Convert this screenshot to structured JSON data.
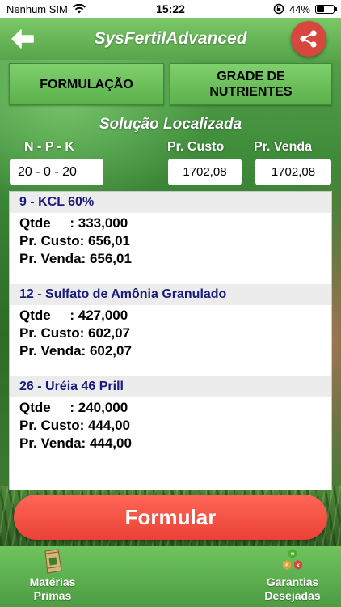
{
  "status_bar": {
    "carrier": "Nenhum SIM",
    "time": "15:22",
    "battery": "44%",
    "battery_level": 0.44
  },
  "header": {
    "title": "SysFertilAdvanced"
  },
  "tabs": [
    {
      "label": "FORMULAÇÃO"
    },
    {
      "label": "GRADE DE NUTRIENTES"
    }
  ],
  "solution": {
    "title": "Solução Localizada",
    "npk_label": "N - P - K",
    "npk_value": "20 - 0 - 20",
    "custo_label": "Pr. Custo",
    "custo_value": "1702,08",
    "venda_label": "Pr. Venda",
    "venda_value": "1702,08"
  },
  "items": [
    {
      "title": "9 - KCL 60%",
      "qtde_label": "Qtde     : ",
      "qtde": "333,000",
      "custo_label": "Pr. Custo: ",
      "custo": "656,01",
      "venda_label": "Pr. Venda: ",
      "venda": "656,01"
    },
    {
      "title": "12 - Sulfato de Amônia Granulado",
      "qtde_label": "Qtde     : ",
      "qtde": "427,000",
      "custo_label": "Pr. Custo: ",
      "custo": "602,07",
      "venda_label": "Pr. Venda: ",
      "venda": "602,07"
    },
    {
      "title": "26 - Uréia 46 Prill",
      "qtde_label": "Qtde     : ",
      "qtde": "240,000",
      "custo_label": "Pr. Custo: ",
      "custo": "444,00",
      "venda_label": "Pr. Venda: ",
      "venda": "444,00"
    }
  ],
  "formular_button": "Formular",
  "bottom_nav": {
    "left_line1": "Matérias",
    "left_line2": "Primas",
    "right_line1": "Garantias",
    "right_line2": "Desejadas",
    "garantias_icon_letters": [
      "N",
      "P",
      "K"
    ]
  },
  "colors": {
    "header_green": "#6abb58",
    "accent_red": "#ea4136",
    "item_title": "#1a1a7e"
  }
}
